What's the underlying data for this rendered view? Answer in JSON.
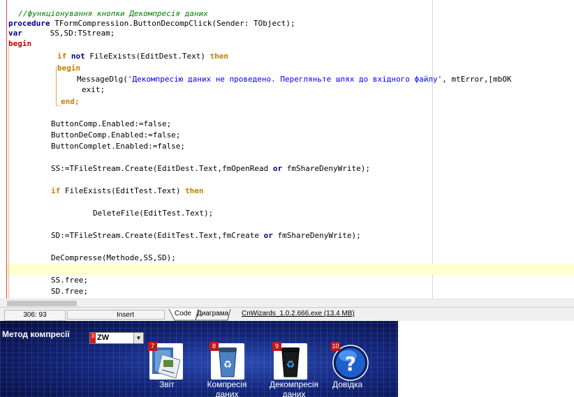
{
  "editor": {
    "lines": {
      "l1": "//функціонування кнопки Декомпресія даних",
      "l2_kw": "procedure",
      "l2_rest": " TFormCompression.ButtonDecompClick(Sender: TObject);",
      "l3_kw": "var",
      "l3_rest": "      SS,SD:TStream;",
      "l4": "begin",
      "l5_a": "if",
      "l5_b": " not",
      "l5_c": " FileExists(EditDest.Text) ",
      "l5_d": "then",
      "l6": "begin",
      "l7_a": "MessageDlg(",
      "l7_b": "'Декомпресію даних не проведено. Перегляньте шлях до вхідного файлу'",
      "l7_c": ", mtError,[mbOK",
      "l8": "exit;",
      "l9": "end;",
      "l10": "ButtonComp.Enabled:=false;",
      "l11": "ButtonDeComp.Enabled:=false;",
      "l12": "ButtonComplet.Enabled:=false;",
      "l13_a": "SS:=TFileStream.Create(EditDest.Text,fmOpenRead ",
      "l13_b": "or",
      "l13_c": " fmShareDenyWrite);",
      "l14_a": "if",
      "l14_b": " FileExists(EditTest.Text) ",
      "l14_c": "then",
      "l15": "DeleteFile(EditTest.Text);",
      "l16_a": "SD:=TFileStream.Create(EditTest.Text,fmCreate ",
      "l16_b": "or",
      "l16_c": " fmShareDenyWrite);",
      "l17": "DeCompresse(Methode,SS,SD);",
      "l18": "SS.free;",
      "l19": "SD.free;"
    }
  },
  "status": {
    "position": "306:  93",
    "mode": "Insert",
    "tab_code": "Code",
    "tab_diagram": "Диаграма",
    "file": "CnWizards_1.0.2.666.exe (13.4 MB)"
  },
  "app": {
    "method_label": "Метод компресії",
    "combo_number": "3",
    "combo_value": "ZW",
    "tiles": [
      {
        "number": "7",
        "caption": "Звіт",
        "icon": "report-icon"
      },
      {
        "number": "8",
        "caption": "Компресія даних",
        "icon": "recycle-bin-blue-icon"
      },
      {
        "number": "9",
        "caption": "Декомпресія даних",
        "icon": "recycle-bin-dark-icon"
      },
      {
        "number": "10",
        "caption": "Довідка",
        "icon": "help-icon"
      }
    ]
  },
  "colors": {
    "comment": "#008000",
    "keyword": "#00008b",
    "keyword_orange": "#c08000",
    "string": "#0000ff",
    "current_line": "#ffffd0",
    "app_background": "#14267a"
  }
}
